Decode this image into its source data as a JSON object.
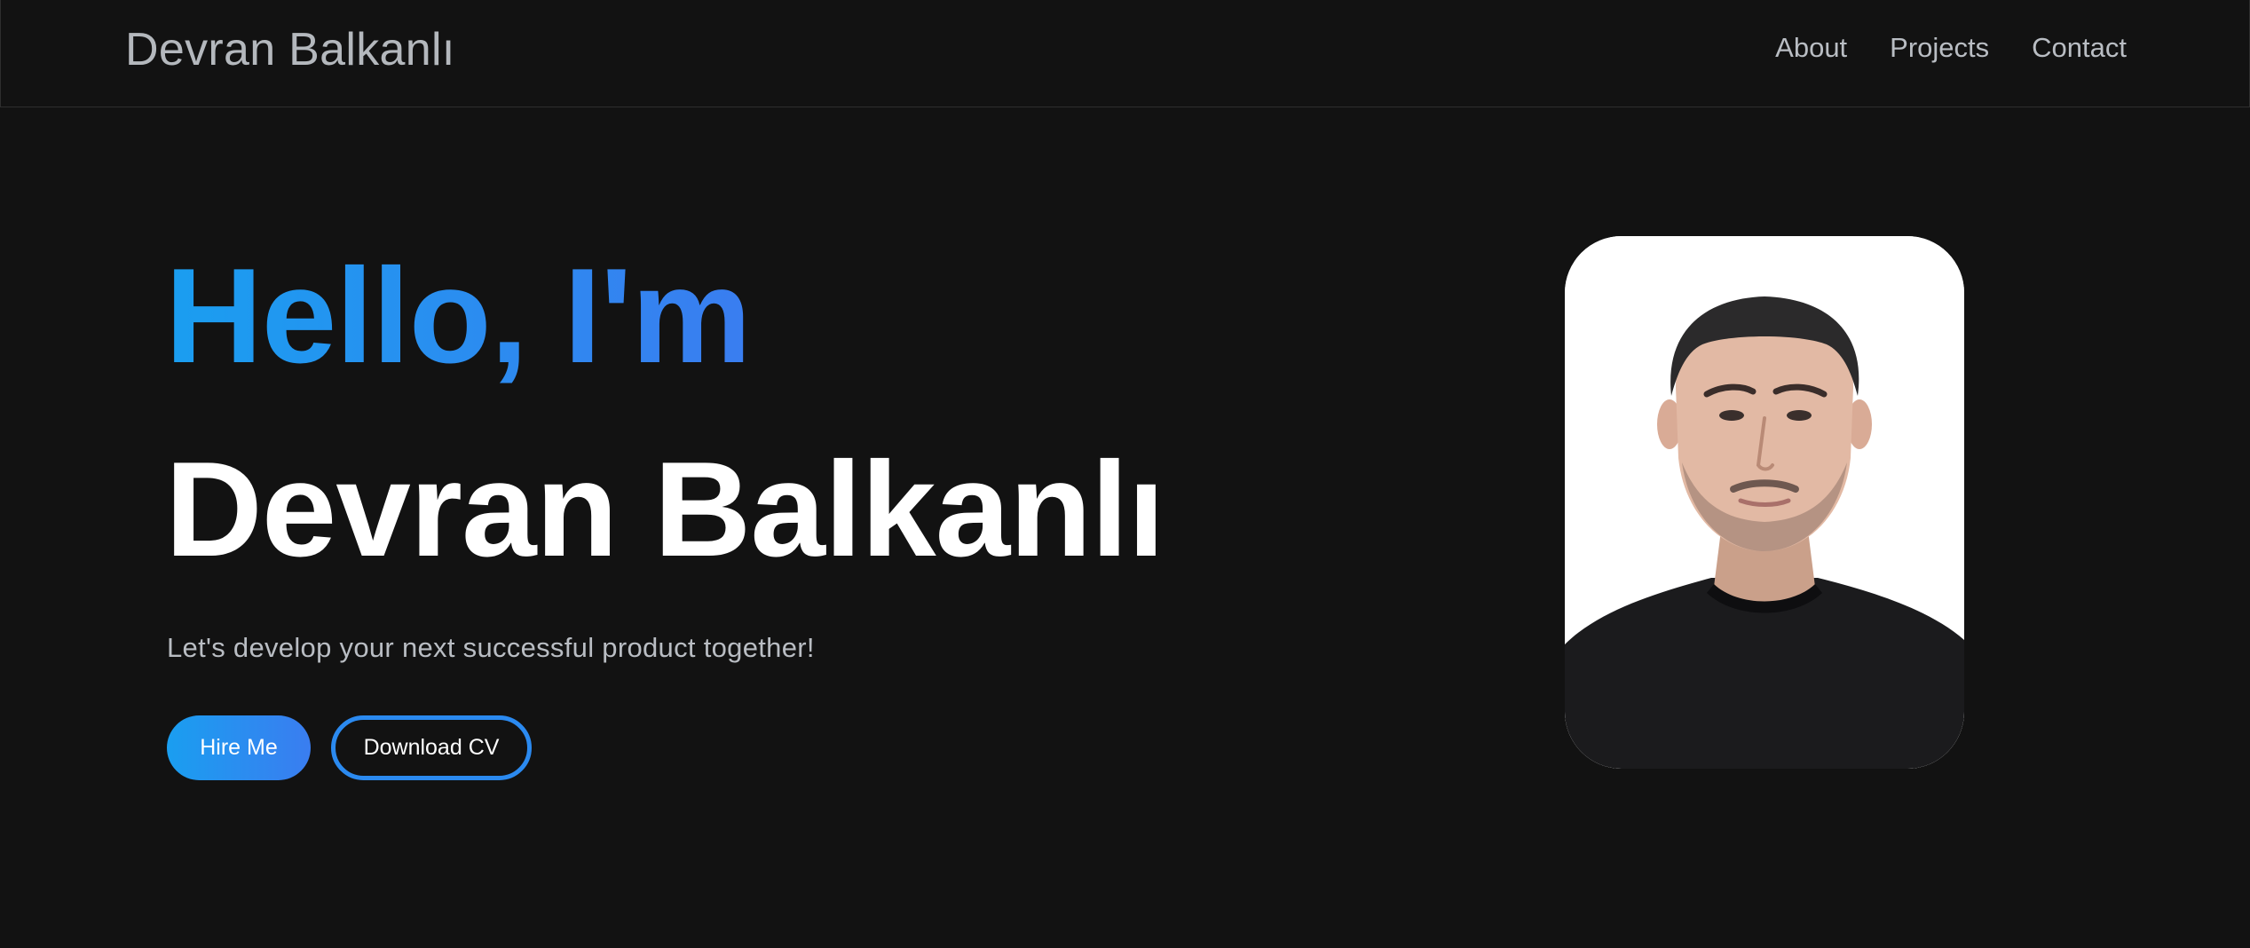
{
  "nav": {
    "brand": "Devran Balkanlı",
    "links": [
      {
        "label": "About"
      },
      {
        "label": "Projects"
      },
      {
        "label": "Contact"
      }
    ]
  },
  "hero": {
    "greeting": "Hello, I'm",
    "name": "Devran Balkanlı",
    "tagline": "Let's develop your next successful product together!",
    "buttons": {
      "hire_label": "Hire Me",
      "cv_label": "Download CV"
    },
    "photo_alt": "Portrait of Devran Balkanlı"
  },
  "colors": {
    "background": "#121212",
    "accent_start": "#1a9ef0",
    "accent_end": "#3a7df0",
    "text_muted": "#b9bdc3",
    "text_primary": "#ffffff"
  }
}
